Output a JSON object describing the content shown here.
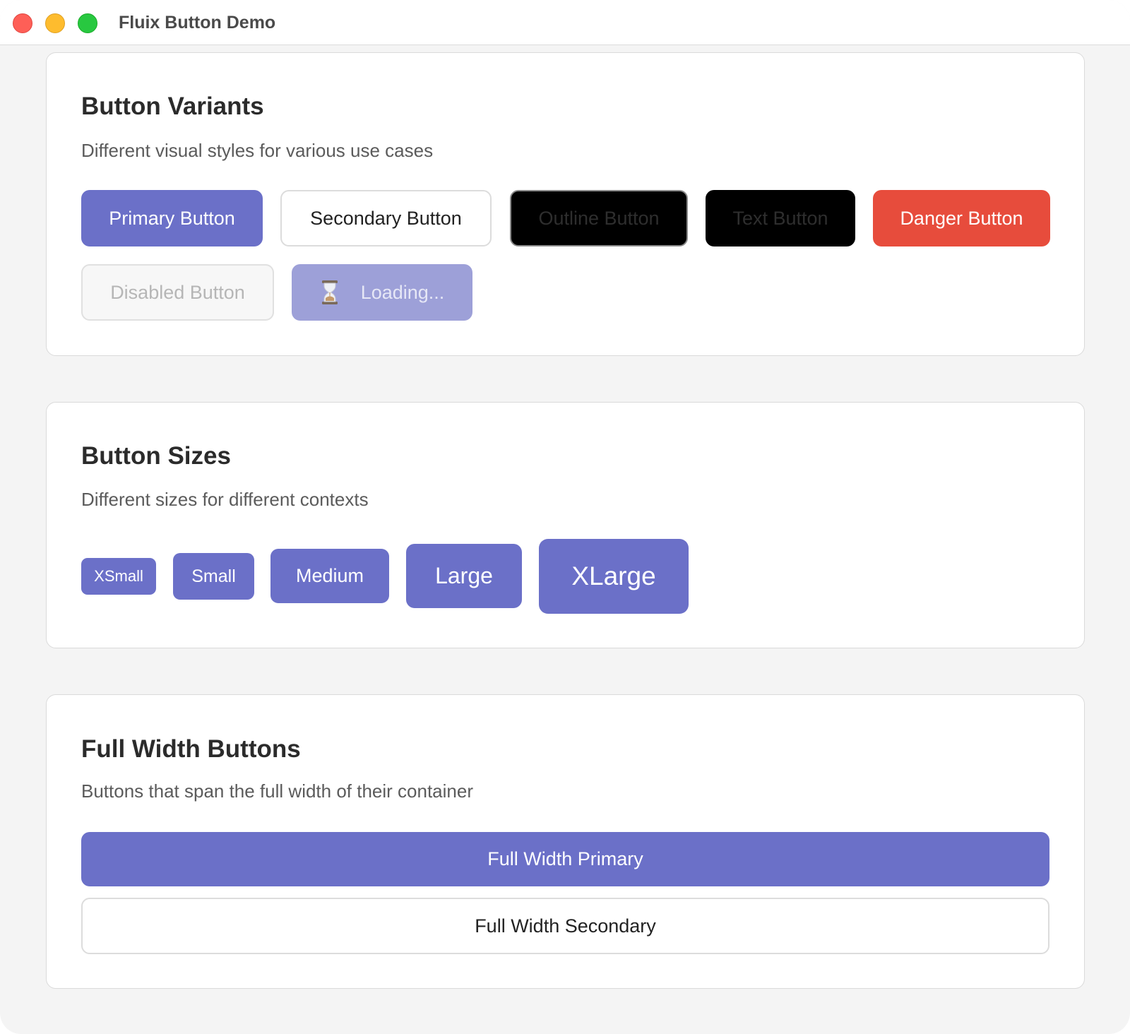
{
  "window": {
    "title": "Fluix Button Demo"
  },
  "variants": {
    "title": "Button Variants",
    "description": "Different visual styles for various use cases",
    "primary": "Primary Button",
    "secondary": "Secondary Button",
    "outline": "Outline Button",
    "text": "Text Button",
    "danger": "Danger Button",
    "disabled": "Disabled Button",
    "loading": "Loading...",
    "loading_icon": "hourglass-icon"
  },
  "sizes": {
    "title": "Button Sizes",
    "description": "Different sizes for different contexts",
    "xsmall": "XSmall",
    "small": "Small",
    "medium": "Medium",
    "large": "Large",
    "xlarge": "XLarge"
  },
  "full_width": {
    "title": "Full Width Buttons",
    "description": "Buttons that span the full width of their container",
    "primary": "Full Width Primary",
    "secondary": "Full Width Secondary"
  },
  "colors": {
    "primary": "#6b70c8",
    "danger": "#e74c3c",
    "loading": "#9da0d8"
  }
}
